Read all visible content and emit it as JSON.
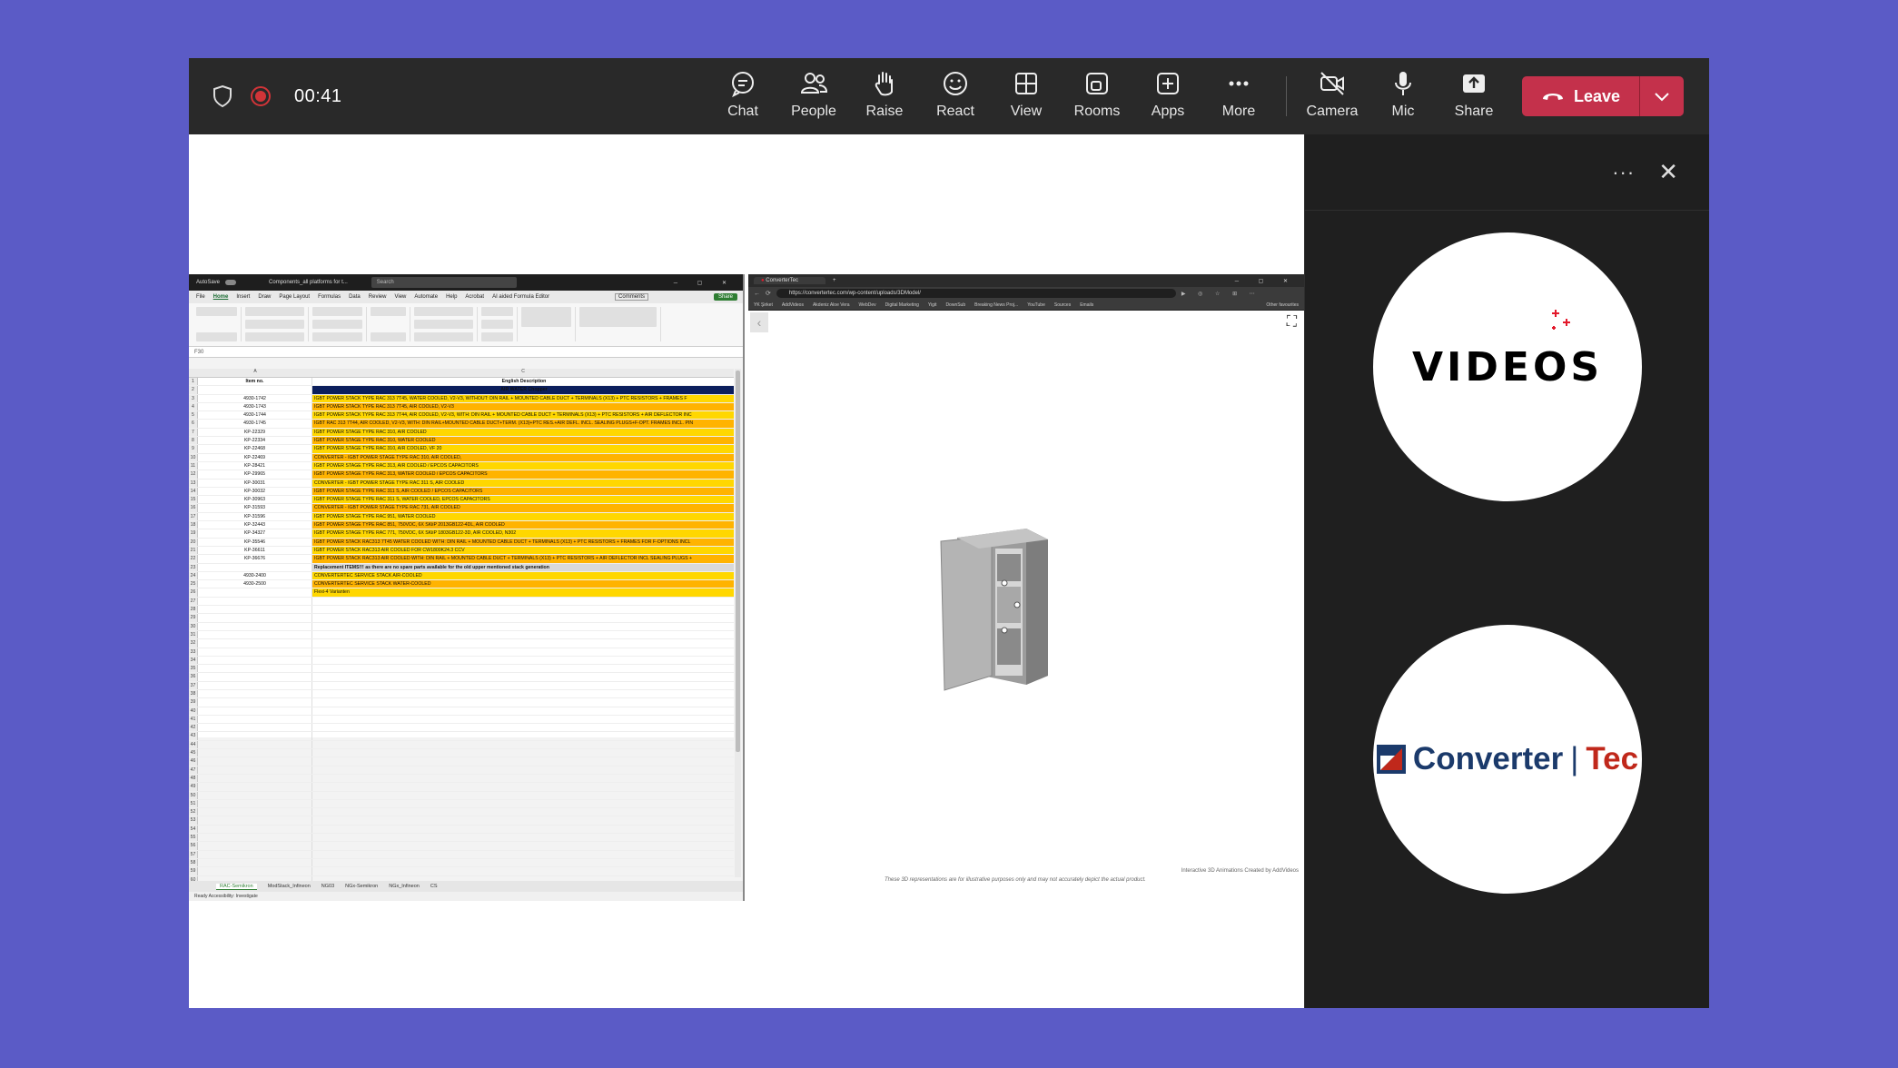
{
  "meeting": {
    "timer": "00:41",
    "toolbar": [
      {
        "label": "Chat",
        "icon": "chat-icon"
      },
      {
        "label": "People",
        "icon": "people-icon"
      },
      {
        "label": "Raise",
        "icon": "raise-hand-icon"
      },
      {
        "label": "React",
        "icon": "react-smiley-icon"
      },
      {
        "label": "View",
        "icon": "view-grid-icon"
      },
      {
        "label": "Rooms",
        "icon": "rooms-icon"
      },
      {
        "label": "Apps",
        "icon": "apps-plus-icon"
      },
      {
        "label": "More",
        "icon": "more-dots-icon"
      },
      {
        "label": "Camera",
        "icon": "camera-off-icon"
      },
      {
        "label": "Mic",
        "icon": "mic-icon"
      },
      {
        "label": "Share",
        "icon": "share-icon"
      }
    ],
    "leave_label": "Leave"
  },
  "excel": {
    "app": "AutoSave",
    "file": "Components_all platforms for t...",
    "search": "Search",
    "menu": [
      "File",
      "Home",
      "Insert",
      "Draw",
      "Page Layout",
      "Formulas",
      "Data",
      "Review",
      "View",
      "Automate",
      "Help",
      "Acrobat",
      "AI aided Formula Editor"
    ],
    "comments": "Comments",
    "share": "Share",
    "cell_ref": "F30",
    "col_a_header": "Item no.",
    "col_b_header": "English Description",
    "subheader": "AIR     WATER     Chopper",
    "rows": [
      {
        "n": "3",
        "a": "4930-1742",
        "b": "IGBT POWER STACK TYPE RAC 313 7T45, WATER COOLED, V2-V3,  WITHOUT: DIN RAIL + MOUNTED CABLE DUCT + TERMINALS (X13) + PTC RESISTORS + FRAMES F",
        "c": "y"
      },
      {
        "n": "4",
        "a": "4930-1743",
        "b": "IGBT POWER STACK TYPE RAC 313 7T45, AIR COOLED, V2-V3",
        "c": "o"
      },
      {
        "n": "5",
        "a": "4930-1744",
        "b": "IGBT POWER STACK TYPE RAC 313 7T44, AIR COOLED, V2-V3, WITH: DIN RAIL + MOUNTED CABLE DUCT + TERMINALS (X13) + PTC RESISTORS + AIR DEFLECTOR INC",
        "c": "y"
      },
      {
        "n": "6",
        "a": "4930-1745",
        "b": "IGBT RAC 313 7T44, AIR COOLED, V2-V3, WITH: DIN RAIL+MOUNTED CABLE DUCT+TERM. (X13)+PTC RES.+AIR DEFL. INCL. SEALING PLUGS+F-OPT. FRAMES INCL. PIN",
        "c": "o"
      },
      {
        "n": "7",
        "a": "KP-22329",
        "b": "IGBT POWER STAGE TYPE RAC 310, AIR COOLED",
        "c": "y"
      },
      {
        "n": "8",
        "a": "KP-22334",
        "b": "IGBT POWER STAGE TYPE RAC 310, WATER COOLED",
        "c": "o"
      },
      {
        "n": "9",
        "a": "KP-22468",
        "b": "IGBT POWER STAGE TYPE RAC 310, AIR COOLED, VF 20",
        "c": "y"
      },
      {
        "n": "10",
        "a": "KP-22469",
        "b": "CONVERTER - IGBT POWER STAGE TYPE RAC 310, AIR COOLED,",
        "c": "o"
      },
      {
        "n": "11",
        "a": "KP-28421",
        "b": "IGBT POWER STAGE TYPE RAC 313, AIR COOLED / EPCOS CAPACITORS",
        "c": "y"
      },
      {
        "n": "12",
        "a": "KP-29965",
        "b": "IGBT POWER STAGE TYPE RAC 313, WATER COOLED / EPCOS CAPACITORS",
        "c": "o"
      },
      {
        "n": "13",
        "a": "KP-30031",
        "b": "CONVERTER - IGBT POWER STAGE TYPE RAC 311 S, AIR COOLED",
        "c": "y"
      },
      {
        "n": "14",
        "a": "KP-30032",
        "b": "IGBT POWER STAGE TYPE RAC 311 S, AIR COOLED / EPCOS CAPACITORS",
        "c": "o"
      },
      {
        "n": "15",
        "a": "KP-30963",
        "b": "IGBT POWER STAGE TYPE RAC 311 S, WATER COOLED, EPCOS CAPACITORS",
        "c": "y"
      },
      {
        "n": "16",
        "a": "KP-31593",
        "b": "CONVERTER - IGBT POWER STAGE TYPE RAC 731, AIR COOLED",
        "c": "o"
      },
      {
        "n": "17",
        "a": "KP-31596",
        "b": "IGBT POWER STAGE TYPE RAC 951, WATER COOLED",
        "c": "y"
      },
      {
        "n": "18",
        "a": "KP-32443",
        "b": "IGBT POWER STAGE TYPE RAC 851, 750VDC, 6X SKiiP 2013GB122-4DL, AIR COOLED",
        "c": "o"
      },
      {
        "n": "19",
        "a": "KP-34327",
        "b": "IGBT POWER STAGE TYPE RAC 771, 750VDC, 6X SKiiP 1803GB122-3D, AIR COOLED, N302",
        "c": "y"
      },
      {
        "n": "20",
        "a": "KP-35546",
        "b": "IGBT POWER STACK RAC313 7T45 WATER COOLED WITH: DIN RAIL + MOUNTED CABLE DUCT + TERMINALS (X13) + PTC RESISTORS + FRAMES FOR F-OPTIONS INCL",
        "c": "o"
      },
      {
        "n": "21",
        "a": "KP-36611",
        "b": "IGBT POWER STACK RAC313 AIR COOLED FOR CW1800K24.3 CCV",
        "c": "y"
      },
      {
        "n": "22",
        "a": "KP-36676",
        "b": "IGBT POWER STACK RAC313 AIR COOLED WITH: DIN RAIL + MOUNTED CABLE DUCT + TERMINALS (X13) + PTC RESISTORS + AIR DEFLECTOR INCL SEALING PLUGS +",
        "c": "o"
      },
      {
        "n": "23",
        "a": "",
        "b": "Replacement ITEMS!!! as there are no spare parts available for the old upper mentioned stack generation",
        "c": "g"
      },
      {
        "n": "24",
        "a": "4930-2400",
        "b": "CONVERTERTEC SERVICE STACK AIR-COOLED",
        "c": "y"
      },
      {
        "n": "25",
        "a": "4930-2500",
        "b": "CONVERTERTEC SERVICE STACK WATER-COOLED",
        "c": "o"
      },
      {
        "n": "26",
        "a": "",
        "b": "Flexi-4 Varianten",
        "c": "y"
      }
    ],
    "sheet_tabs": [
      "RAC-Semikron",
      "ModStack_Infineon",
      "NG03",
      "NGx-Semikron",
      "NGx_Infineon",
      "CS"
    ],
    "status": "Ready    Accessibility: Investigate"
  },
  "browser": {
    "tab_title": "ConverterTec",
    "url": "https://convertertec.com/wp-content/uploads/3DModel/",
    "bookmarks": [
      "YK Şirket",
      "AddVideos",
      "Akdeniz Aloe Vera",
      "WebDev",
      "Digital Marketing",
      "Yigit",
      "DownSub",
      "Breaking News Proj...",
      "YouTube",
      "Sources",
      "Emails",
      "Other favourites"
    ],
    "caption_disclaimer": "These 3D representations are for illustrative purposes only and may not accurately depict the actual product.",
    "caption_credit": "Interactive 3D Animations Created by AddVideos"
  },
  "participants": [
    {
      "name_logo": "VIDEOS",
      "brand_color": "#e3192b"
    },
    {
      "logo_part1": "Converter",
      "logo_sep": "|",
      "logo_part2": "Tec",
      "brand_color": "#c0281b"
    }
  ],
  "colors": {
    "accent": "#5b5bc6",
    "leave": "#c4314b",
    "record": "#d13438"
  }
}
